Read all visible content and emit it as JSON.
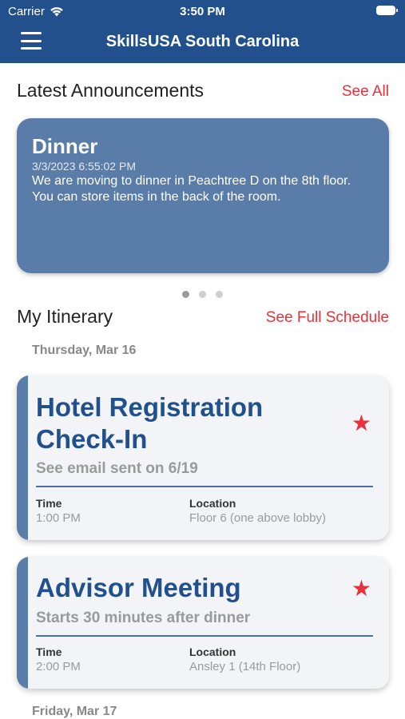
{
  "status_bar": {
    "carrier": "Carrier",
    "time": "3:50 PM"
  },
  "header": {
    "title": "SkillsUSA South Carolina"
  },
  "announcements": {
    "heading": "Latest Announcements",
    "see_all": "See All",
    "card": {
      "title": "Dinner",
      "date": "3/3/2023 6:55:02 PM",
      "body": "We are moving to dinner in Peachtree D on the 8th floor. You can store items in the back of the room."
    }
  },
  "itinerary": {
    "heading": "My Itinerary",
    "see_full": "See Full Schedule",
    "days": [
      {
        "label": "Thursday, Mar 16",
        "events": [
          {
            "title": "Hotel Registration Check-In",
            "subtitle": "See email sent on 6/19",
            "time_label": "Time",
            "time": "1:00 PM",
            "location_label": "Location",
            "location": "Floor 6 (one above lobby)"
          },
          {
            "title": "Advisor Meeting",
            "subtitle": "Starts 30 minutes after dinner",
            "time_label": "Time",
            "time": "2:00 PM",
            "location_label": "Location",
            "location": "Ansley 1 (14th Floor)"
          }
        ]
      },
      {
        "label": "Friday, Mar 17",
        "events": []
      }
    ]
  },
  "colors": {
    "primary": "#21508c",
    "accent": "#e8323b",
    "card": "#5a7ca8"
  },
  "icons": {
    "menu": "hamburger-menu-icon",
    "favorite": "star-icon",
    "wifi": "wifi-icon"
  }
}
